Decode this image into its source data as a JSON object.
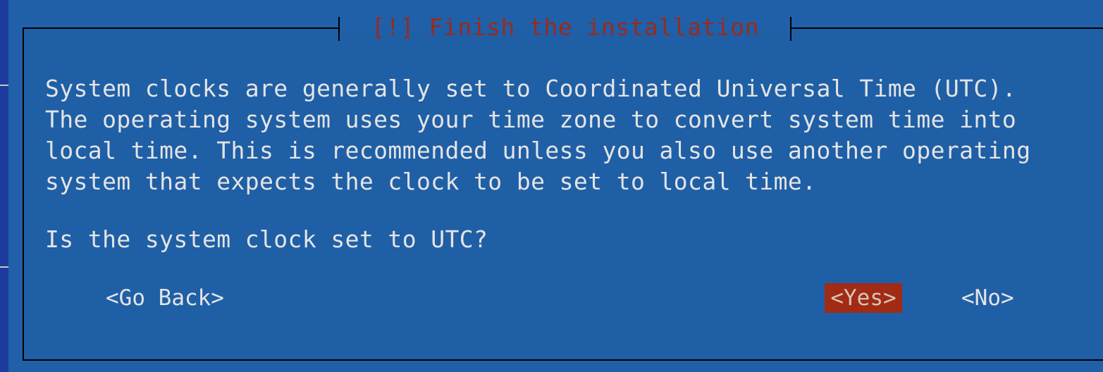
{
  "dialog": {
    "title": "[!] Finish the installation",
    "message": "System clocks are generally set to Coordinated Universal Time (UTC).\nThe operating system uses your time zone to convert system time into\nlocal time. This is recommended unless you also use another operating\nsystem that expects the clock to be set to local time.",
    "question": "Is the system clock set to UTC?"
  },
  "buttons": {
    "back": "<Go Back>",
    "yes": "<Yes>",
    "no": "<No>"
  },
  "colors": {
    "background": "#2060a8",
    "title": "#9b2a1e",
    "text": "#e4e4e4",
    "selected_button": "#a12b14"
  }
}
